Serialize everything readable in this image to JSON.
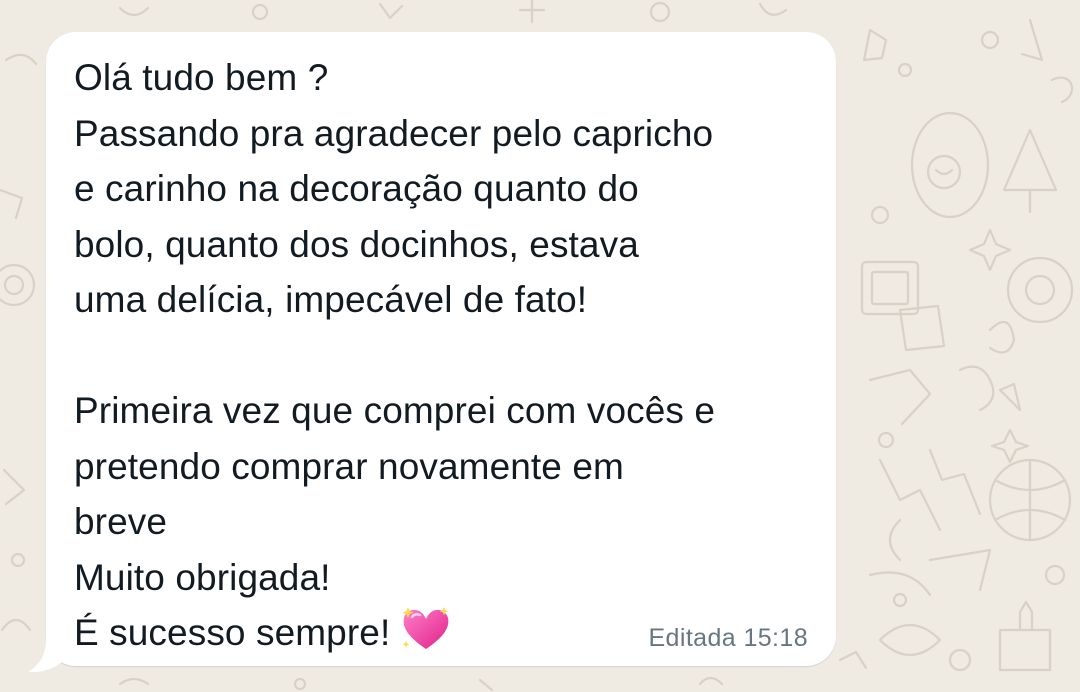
{
  "chat": {
    "wallpaper_color": "#efeae2",
    "bubble_color": "#ffffff",
    "message": {
      "lines": [
        "Olá tudo bem ?",
        "Passando pra agradecer pelo capricho",
        "e carinho na decoração quanto do",
        "bolo, quanto dos docinhos, estava",
        "uma delícia, impecável de fato!",
        "",
        "Primeira vez que comprei com vocês e",
        "pretendo comprar novamente em",
        "breve",
        "Muito obrigada!",
        "É sucesso sempre!"
      ],
      "trailing_emoji": "sparkling-heart-icon",
      "edited_label": "Editada",
      "time": "15:18"
    }
  }
}
